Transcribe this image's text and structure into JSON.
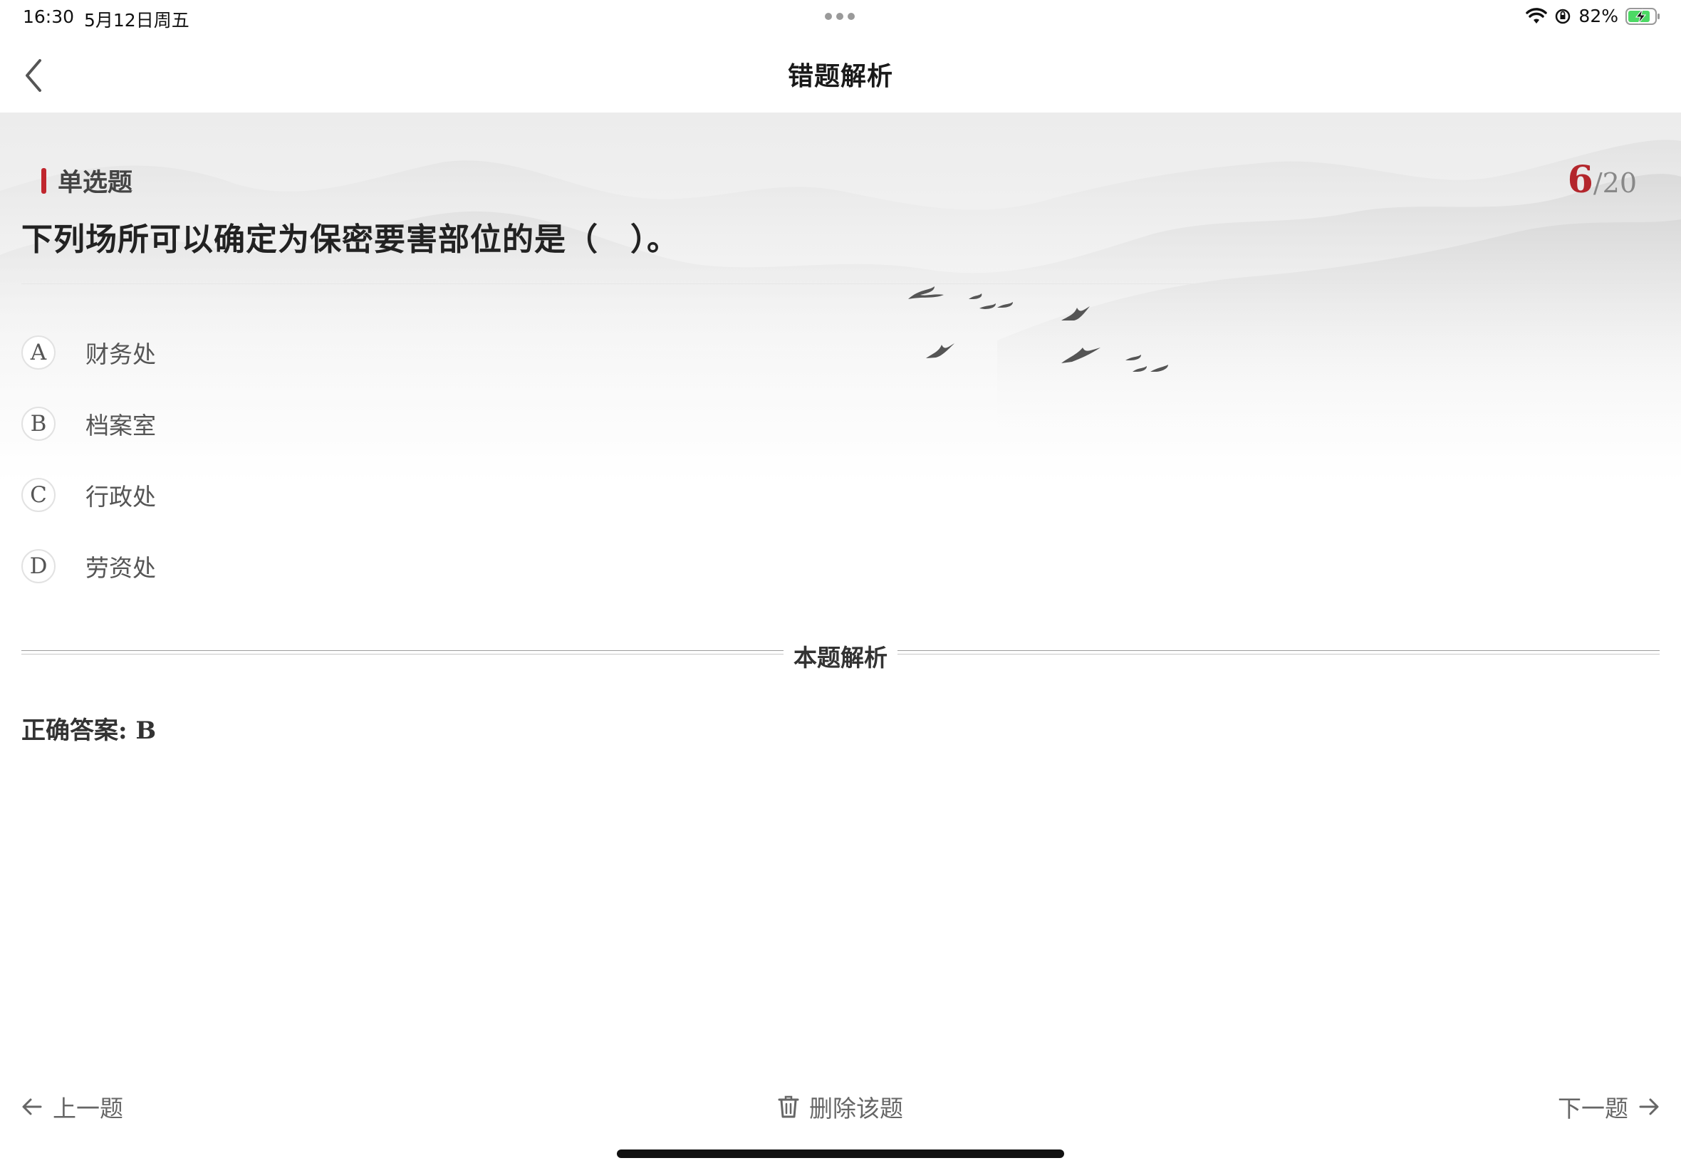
{
  "status_bar": {
    "time": "16:30",
    "date": "5月12日周五",
    "battery_percent": "82%",
    "icons": [
      "more-dots-icon",
      "wifi-icon",
      "orientation-lock-icon",
      "battery-charging-icon"
    ]
  },
  "nav": {
    "title": "错题解析",
    "back_icon": "chevron-left-icon"
  },
  "question": {
    "type_label": "单选题",
    "current": "6",
    "total": "/20",
    "text": "下列场所可以确定为保密要害部位的是（　）。",
    "options": [
      {
        "letter": "A",
        "text": "财务处"
      },
      {
        "letter": "B",
        "text": "档案室"
      },
      {
        "letter": "C",
        "text": "行政处"
      },
      {
        "letter": "D",
        "text": "劳资处"
      }
    ]
  },
  "analysis": {
    "title": "本题解析",
    "correct_answer": "正确答案: B"
  },
  "toolbar": {
    "prev_label": "上一题",
    "delete_label": "删除该题",
    "next_label": "下一题",
    "prev_icon": "arrow-left-icon",
    "delete_icon": "trash-icon",
    "next_icon": "arrow-right-icon"
  },
  "colors": {
    "accent_red": "#b3262c",
    "text_primary": "#222222",
    "text_secondary": "#666666"
  }
}
